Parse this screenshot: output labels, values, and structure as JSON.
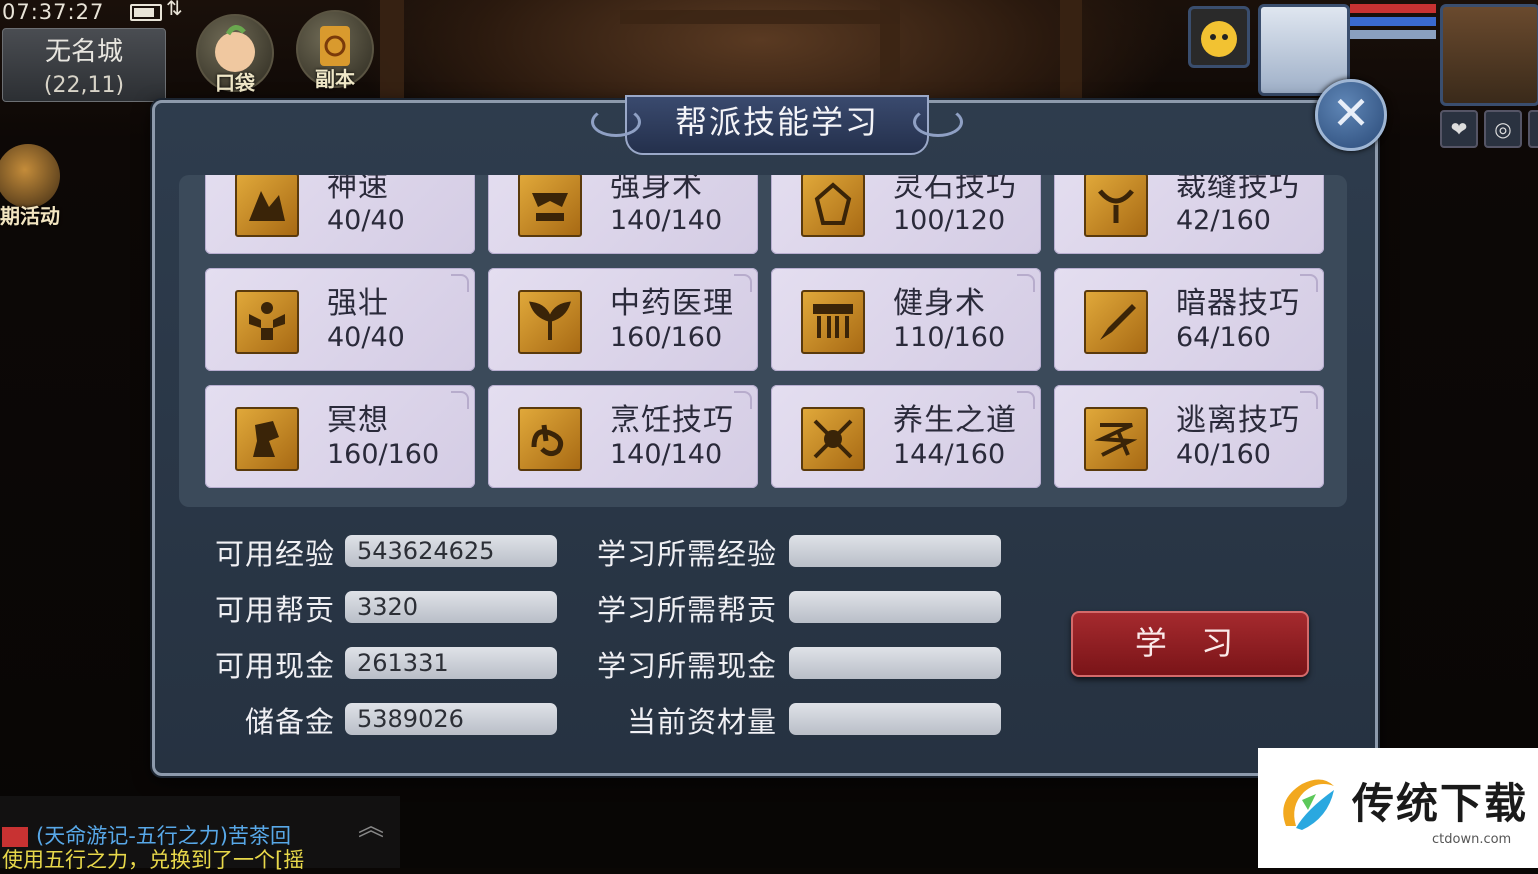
{
  "status_bar": {
    "clock": "07:37:27",
    "signal": "⇅"
  },
  "map": {
    "name": "无名城",
    "coords": "(22,11)"
  },
  "quick_buttons": [
    {
      "label": "口袋",
      "icon": "pocket-icon"
    },
    {
      "label": "副本",
      "icon": "dungeon-icon"
    }
  ],
  "activity": {
    "label": "期活动"
  },
  "dialog": {
    "title": "帮派技能学习",
    "close_icon": "close-icon",
    "skills": [
      {
        "name": "神速",
        "level": "40/40",
        "icon": "speed-icon"
      },
      {
        "name": "强身术",
        "level": "140/140",
        "icon": "body-strength-icon"
      },
      {
        "name": "灵石技巧",
        "level": "100/120",
        "icon": "spirit-stone-icon"
      },
      {
        "name": "裁缝技巧",
        "level": "42/160",
        "icon": "tailoring-icon"
      },
      {
        "name": "强壮",
        "level": "40/40",
        "icon": "strong-icon"
      },
      {
        "name": "中药医理",
        "level": "160/160",
        "icon": "herbal-medicine-icon"
      },
      {
        "name": "健身术",
        "level": "110/160",
        "icon": "fitness-icon"
      },
      {
        "name": "暗器技巧",
        "level": "64/160",
        "icon": "hidden-weapon-icon"
      },
      {
        "name": "冥想",
        "level": "160/160",
        "icon": "meditation-icon"
      },
      {
        "name": "烹饪技巧",
        "level": "140/140",
        "icon": "cooking-icon"
      },
      {
        "name": "养生之道",
        "level": "144/160",
        "icon": "health-preservation-icon"
      },
      {
        "name": "逃离技巧",
        "level": "40/160",
        "icon": "escape-icon"
      }
    ],
    "available": [
      {
        "label": "可用经验",
        "value": "543624625"
      },
      {
        "label": "可用帮贡",
        "value": "3320"
      },
      {
        "label": "可用现金",
        "value": "261331"
      },
      {
        "label": "储备金",
        "value": "5389026"
      }
    ],
    "required": [
      {
        "label": "学习所需经验",
        "value": ""
      },
      {
        "label": "学习所需帮贡",
        "value": ""
      },
      {
        "label": "学习所需现金",
        "value": ""
      },
      {
        "label": "当前资材量",
        "value": ""
      }
    ],
    "learn_button": "学 习"
  },
  "chat": {
    "line1": "(天命游记-五行之力)苦茶回",
    "line2": "使用五行之力，兑换到了一个[摇"
  },
  "watermark": {
    "text": "传统下载",
    "url": "ctdown.com"
  },
  "colors": {
    "dialog_bg": "#2e3c4d",
    "card_bg": "#e4def0",
    "learn_red": "#a52a2e",
    "skill_icon_gold": "#e0a83a"
  }
}
